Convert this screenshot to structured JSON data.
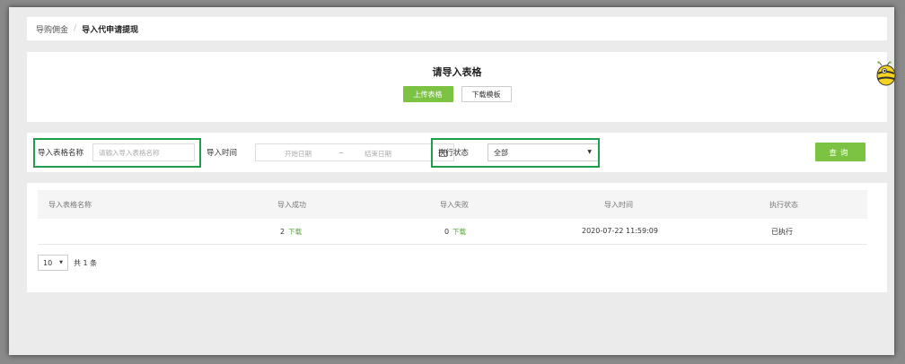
{
  "breadcrumb": {
    "parent": "导购佣金",
    "separator": "/",
    "current": "导入代申请提现"
  },
  "import_card": {
    "title": "请导入表格",
    "upload_label": "上传表格",
    "download_template_label": "下载模板"
  },
  "filters": {
    "name_label": "导入表格名称",
    "name_placeholder": "请输入导入表格名称",
    "time_label": "导入时间",
    "start_placeholder": "开始日期",
    "range_sep": "~",
    "end_placeholder": "结束日期",
    "status_label": "执行状态",
    "status_value": "全部",
    "query_label": "查询"
  },
  "table": {
    "headers": [
      "导入表格名称",
      "导入成功",
      "导入失败",
      "导入时间",
      "执行状态"
    ],
    "rows": [
      {
        "name": "",
        "success": "2",
        "success_link": "下载",
        "fail": "0",
        "fail_link": "下载",
        "time": "2020-07-22 11:59:09",
        "status": "已执行"
      }
    ]
  },
  "pagination": {
    "page_size": "10",
    "total_text": "共 1 条"
  },
  "colors": {
    "accent": "#7cc243",
    "highlight": "#1e9e4a"
  }
}
